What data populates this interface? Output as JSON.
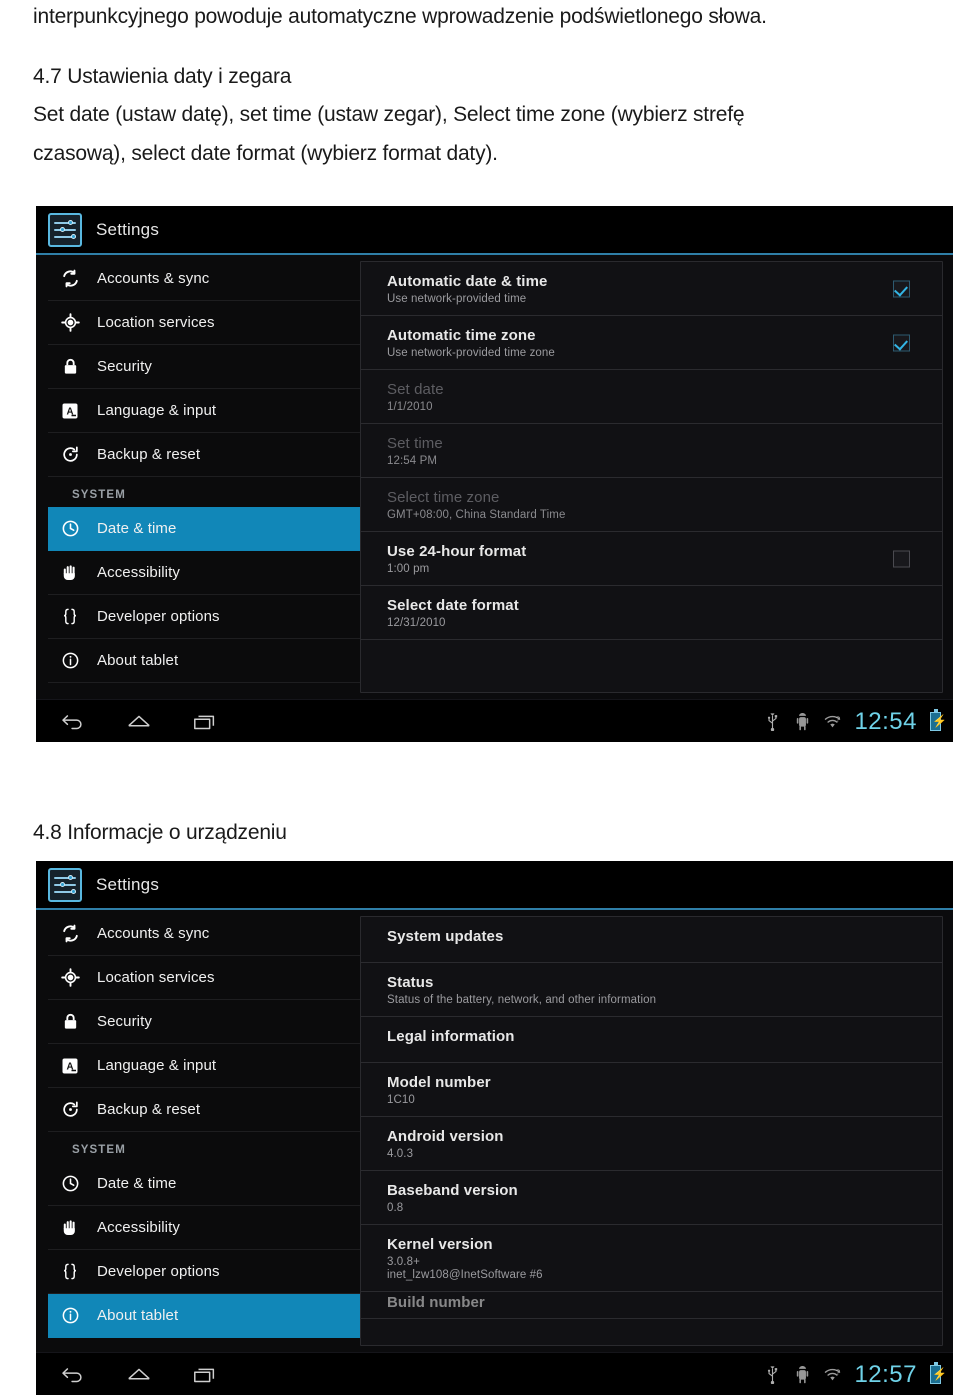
{
  "document": {
    "paragraph_1": "interpunkcyjnego powoduje automatyczne wprowadzenie podświetlonego słowa.",
    "heading_4_7": "4.7 Ustawienia daty i zegara",
    "body_line_1": "Set date (ustaw datę), set time (ustaw zegar), Select time zone (wybierz strefę",
    "body_line_2": "czasową), select date format (wybierz format daty).",
    "heading_4_8": "4.8 Informacje o urządzeniu"
  },
  "colors": {
    "accent_selected": "#1187b8",
    "checkbox_check": "#33b5e5",
    "clock": "#6fd2e8",
    "app_bar_border": "#2f7fa8"
  },
  "screenshot_date_time": {
    "app_title": "Settings",
    "app_icon": "settings-sliders-icon",
    "sidebar": {
      "items": [
        {
          "label": "Accounts & sync",
          "icon": "sync-icon",
          "selected": false
        },
        {
          "label": "Location services",
          "icon": "location-icon",
          "selected": false
        },
        {
          "label": "Security",
          "icon": "lock-icon",
          "selected": false
        },
        {
          "label": "Language & input",
          "icon": "language-icon",
          "selected": false
        },
        {
          "label": "Backup & reset",
          "icon": "backup-icon",
          "selected": false
        }
      ],
      "section_header": "SYSTEM",
      "system_items": [
        {
          "label": "Date & time",
          "icon": "clock-icon",
          "selected": true
        },
        {
          "label": "Accessibility",
          "icon": "hand-icon",
          "selected": false
        },
        {
          "label": "Developer options",
          "icon": "braces-icon",
          "selected": false
        },
        {
          "label": "About tablet",
          "icon": "info-icon",
          "selected": false
        }
      ]
    },
    "preferences": [
      {
        "title": "Automatic date & time",
        "subtitle": "Use network-provided time",
        "dim": false,
        "control": "checkbox",
        "checked": true
      },
      {
        "title": "Automatic time zone",
        "subtitle": "Use network-provided time zone",
        "dim": false,
        "control": "checkbox",
        "checked": true
      },
      {
        "title": "Set date",
        "subtitle": "1/1/2010",
        "dim": true,
        "control": "none",
        "checked": false
      },
      {
        "title": "Set time",
        "subtitle": "12:54 PM",
        "dim": true,
        "control": "none",
        "checked": false
      },
      {
        "title": "Select time zone",
        "subtitle": "GMT+08:00, China Standard Time",
        "dim": true,
        "control": "none",
        "checked": false
      },
      {
        "title": "Use 24-hour format",
        "subtitle": "1:00 pm",
        "dim": false,
        "control": "checkbox",
        "checked": false
      },
      {
        "title": "Select date format",
        "subtitle": "12/31/2010",
        "dim": false,
        "control": "none",
        "checked": false
      }
    ],
    "system_bar": {
      "back_icon": "back-arrow-icon",
      "home_icon": "home-icon",
      "recents_icon": "recent-apps-icon",
      "status_icons": [
        "usb-icon",
        "android-debug-icon",
        "wifi-unknown-icon"
      ],
      "clock": "12:54",
      "battery_icon": "battery-charging-icon"
    }
  },
  "screenshot_about_tablet": {
    "app_title": "Settings",
    "app_icon": "settings-sliders-icon",
    "sidebar": {
      "items": [
        {
          "label": "Accounts & sync",
          "icon": "sync-icon",
          "selected": false
        },
        {
          "label": "Location services",
          "icon": "location-icon",
          "selected": false
        },
        {
          "label": "Security",
          "icon": "lock-icon",
          "selected": false
        },
        {
          "label": "Language & input",
          "icon": "language-icon",
          "selected": false
        },
        {
          "label": "Backup & reset",
          "icon": "backup-icon",
          "selected": false
        }
      ],
      "section_header": "SYSTEM",
      "system_items": [
        {
          "label": "Date & time",
          "icon": "clock-icon",
          "selected": false
        },
        {
          "label": "Accessibility",
          "icon": "hand-icon",
          "selected": false
        },
        {
          "label": "Developer options",
          "icon": "braces-icon",
          "selected": false
        },
        {
          "label": "About tablet",
          "icon": "info-icon",
          "selected": true
        }
      ]
    },
    "preferences": [
      {
        "title": "System updates",
        "subtitle": "",
        "subtitle2": "",
        "dim": false
      },
      {
        "title": "Status",
        "subtitle": "Status of the battery, network, and other information",
        "subtitle2": "",
        "dim": false
      },
      {
        "title": "Legal information",
        "subtitle": "",
        "subtitle2": "",
        "dim": false
      },
      {
        "title": "Model number",
        "subtitle": "1C10",
        "subtitle2": "",
        "dim": false
      },
      {
        "title": "Android version",
        "subtitle": "4.0.3",
        "subtitle2": "",
        "dim": false
      },
      {
        "title": "Baseband version",
        "subtitle": "0.8",
        "subtitle2": "",
        "dim": false
      },
      {
        "title": "Kernel version",
        "subtitle": "3.0.8+",
        "subtitle2": "inet_lzw108@InetSoftware #6",
        "dim": false
      },
      {
        "title": "Build number",
        "subtitle": "",
        "subtitle2": "",
        "dim": false,
        "clipped": true
      }
    ],
    "system_bar": {
      "back_icon": "back-arrow-icon",
      "home_icon": "home-icon",
      "recents_icon": "recent-apps-icon",
      "status_icons": [
        "usb-icon",
        "android-debug-icon",
        "wifi-unknown-icon"
      ],
      "clock": "12:57",
      "battery_icon": "battery-charging-icon"
    }
  }
}
